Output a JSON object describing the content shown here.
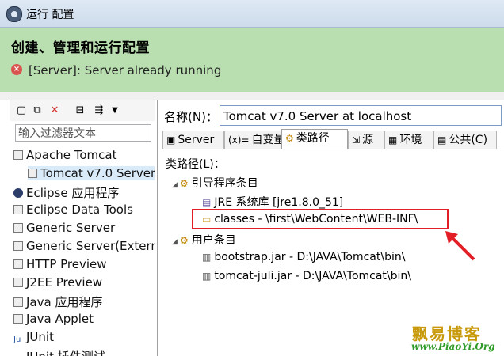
{
  "window": {
    "title": "运行 配置"
  },
  "header": {
    "title": "创建、管理和运行配置",
    "message": "[Server]: Server already running"
  },
  "left": {
    "filter_placeholder": "输入过滤器文本",
    "items": [
      "Apache Tomcat",
      "Tomcat v7.0 Server",
      "Eclipse 应用程序",
      "Eclipse Data Tools",
      "Generic Server",
      "Generic Server(Externa",
      "HTTP Preview",
      "J2EE Preview",
      "Java 应用程序",
      "Java Applet",
      "JUnit",
      "JUnit 插件测试"
    ]
  },
  "right": {
    "name_label": "名称(N)：",
    "name_value": "Tomcat v7.0 Server at localhost",
    "tabs": [
      "Server",
      "自变量",
      "类路径",
      "源",
      "环境",
      "公共(C)"
    ],
    "classpath_label": "类路径(L)：",
    "bootstrap_entries": "引导程序条目",
    "jre": "JRE 系统库 [jre1.8.0_51]",
    "classes": "classes - \\first\\WebContent\\WEB-INF\\",
    "user_entries": "用户条目",
    "bootstrap_jar": "bootstrap.jar - D:\\JAVA\\Tomcat\\bin\\",
    "juli_jar": "tomcat-juli.jar - D:\\JAVA\\Tomcat\\bin\\"
  },
  "watermark": {
    "name": "飘易博客",
    "url": "www.PiaoYi.Org"
  },
  "colors": {
    "header_bg": "#b9dfb0",
    "highlight": "#e21f26",
    "selection": "#d9ebf9"
  }
}
